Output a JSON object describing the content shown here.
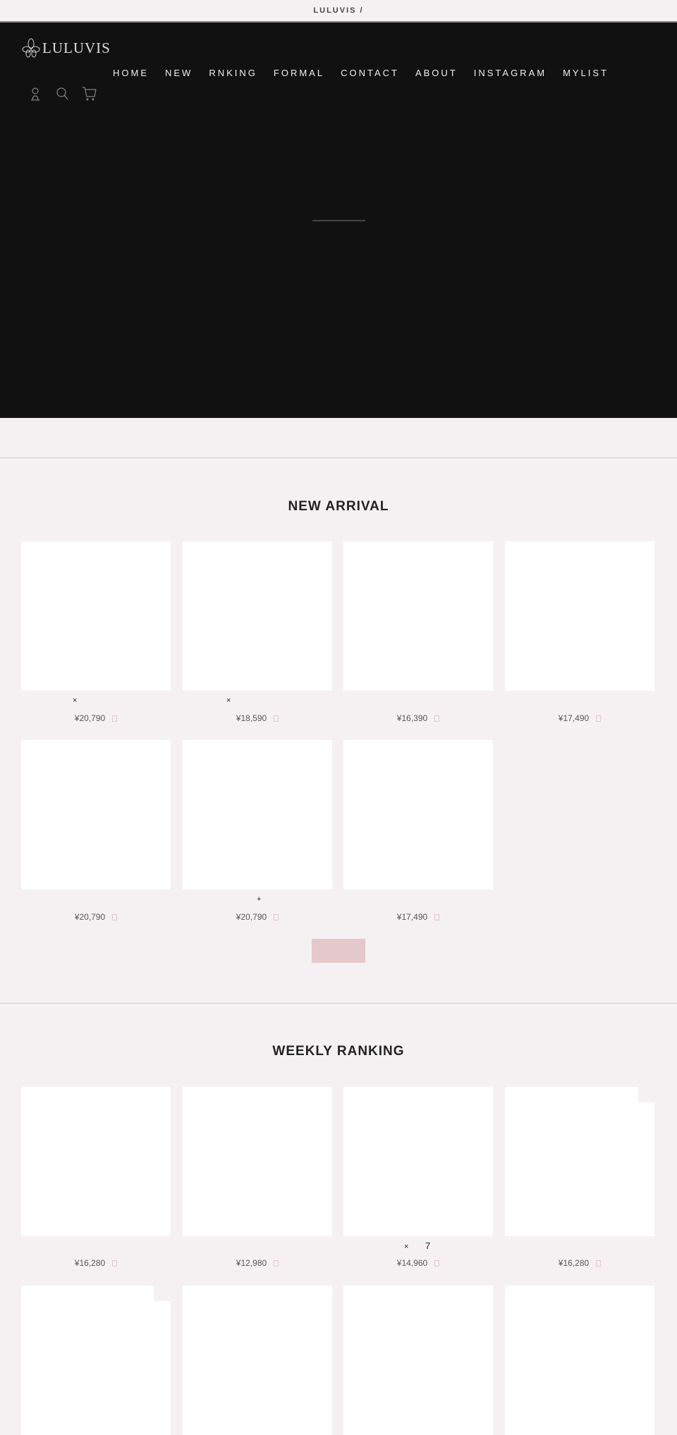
{
  "topbar": {
    "text": "LULUVIS /"
  },
  "logo": {
    "text": "LULUVIS"
  },
  "nav": [
    "HOME",
    "NEW",
    "RNKING",
    "FORMAL",
    "CONTACT",
    "ABOUT",
    "INSTAGRAM",
    "MYLIST"
  ],
  "icons": [
    "user-icon",
    "search-icon",
    "cart-icon"
  ],
  "new_arrival": {
    "title": "NEW ARRIVAL",
    "prices": [
      "¥20,790",
      "¥18,590",
      "¥16,390",
      "¥17,490",
      "¥20,790",
      "¥20,790",
      "¥17,490"
    ],
    "marks": [
      "×",
      "×",
      "+"
    ]
  },
  "weekly_ranking": {
    "title": "WEEKLY RANKING",
    "prices": [
      "¥16,280",
      "¥12,980",
      "¥14,960",
      "¥16,280"
    ],
    "marks": [
      "×",
      "7"
    ]
  },
  "colors": {
    "hero": "#111111",
    "background": "#f5f1f2",
    "more_button": "#e5c8cc"
  }
}
